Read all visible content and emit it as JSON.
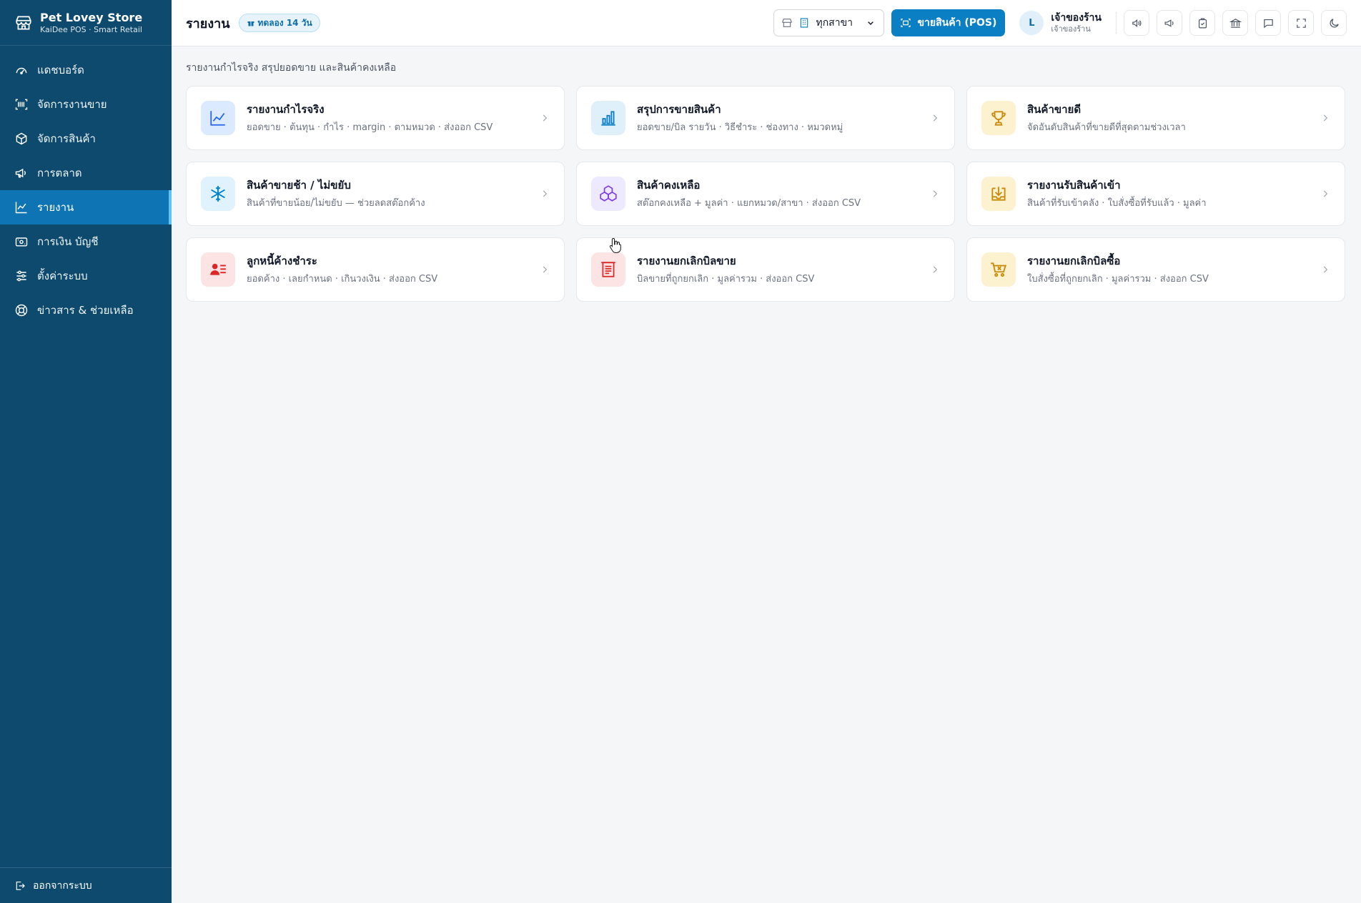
{
  "brand": {
    "name": "Pet Lovey Store",
    "subtitle": "KaiDee POS · Smart Retail"
  },
  "sidebar": {
    "items": [
      {
        "label": "แดชบอร์ด",
        "icon": "gauge-icon"
      },
      {
        "label": "จัดการงานขาย",
        "icon": "barcode-scan-icon"
      },
      {
        "label": "จัดการสินค้า",
        "icon": "box-icon"
      },
      {
        "label": "การตลาด",
        "icon": "megaphone-icon"
      },
      {
        "label": "รายงาน",
        "icon": "line-chart-icon",
        "active": true
      },
      {
        "label": "การเงิน บัญชี",
        "icon": "wallet-icon"
      },
      {
        "label": "ตั้งค่าระบบ",
        "icon": "sliders-icon"
      },
      {
        "label": "ข่าวสาร & ช่วยเหลือ",
        "icon": "lifebuoy-icon"
      }
    ],
    "logout_label": "ออกจากระบบ"
  },
  "header": {
    "title": "รายงาน",
    "trial_badge": "ทดลอง 14 วัน",
    "branch_select": "ทุกสาขา",
    "pos_button": "ขายสินค้า (POS)",
    "user": {
      "initial": "L",
      "name": "เจ้าของร้าน",
      "role": "เจ้าของร้าน"
    }
  },
  "main": {
    "subtitle": "รายงานกำไรจริง สรุปยอดขาย และสินค้าคงเหลือ",
    "cards": [
      {
        "title": "รายงานกำไรจริง",
        "desc": "ยอดขาย · ต้นทุน · กำไร · margin · ตามหมวด · ส่งออก CSV",
        "icon": "trend-chart-icon",
        "bg": "#dbeafe",
        "color": "#2563eb"
      },
      {
        "title": "สรุปการขายสินค้า",
        "desc": "ยอดขาย/บิล รายวัน · วิธีชำระ · ช่องทาง · หมวดหมู่",
        "icon": "bar-chart-icon",
        "bg": "#dff0fb",
        "color": "#0b7fc4"
      },
      {
        "title": "สินค้าขายดี",
        "desc": "จัดอันดับสินค้าที่ขายดีที่สุดตามช่วงเวลา",
        "icon": "trophy-icon",
        "bg": "#fdf2d0",
        "color": "#c98a0a"
      },
      {
        "title": "สินค้าขายช้า / ไม่ขยับ",
        "desc": "สินค้าที่ขายน้อย/ไม่ขยับ — ช่วยลดสต๊อกค้าง",
        "icon": "snowflake-icon",
        "bg": "#e0f2fe",
        "color": "#0284c7"
      },
      {
        "title": "สินค้าคงเหลือ",
        "desc": "สต๊อกคงเหลือ + มูลค่า · แยกหมวด/สาขา · ส่งออก CSV",
        "icon": "boxes-icon",
        "bg": "#ede9fe",
        "color": "#7c3aed"
      },
      {
        "title": "รายงานรับสินค้าเข้า",
        "desc": "สินค้าที่รับเข้าคลัง · ใบสั่งซื้อที่รับแล้ว · มูลค่า",
        "icon": "inbox-download-icon",
        "bg": "#fdf2d0",
        "color": "#c98a0a"
      },
      {
        "title": "ลูกหนี้ค้างชำระ",
        "desc": "ยอดค้าง · เลยกำหนด · เกินวงเงิน · ส่งออก CSV",
        "icon": "user-list-icon",
        "bg": "#fde4e4",
        "color": "#dc2626"
      },
      {
        "title": "รายงานยกเลิกบิลขาย",
        "desc": "บิลขายที่ถูกยกเลิก · มูลค่ารวม · ส่งออก CSV",
        "icon": "receipt-icon",
        "bg": "#fde4e4",
        "color": "#dc2626"
      },
      {
        "title": "รายงานยกเลิกบิลซื้อ",
        "desc": "ใบสั่งซื้อที่ถูกยกเลิก · มูลค่ารวม · ส่งออก CSV",
        "icon": "cart-x-icon",
        "bg": "#fdf2d0",
        "color": "#c98a0a"
      }
    ]
  }
}
